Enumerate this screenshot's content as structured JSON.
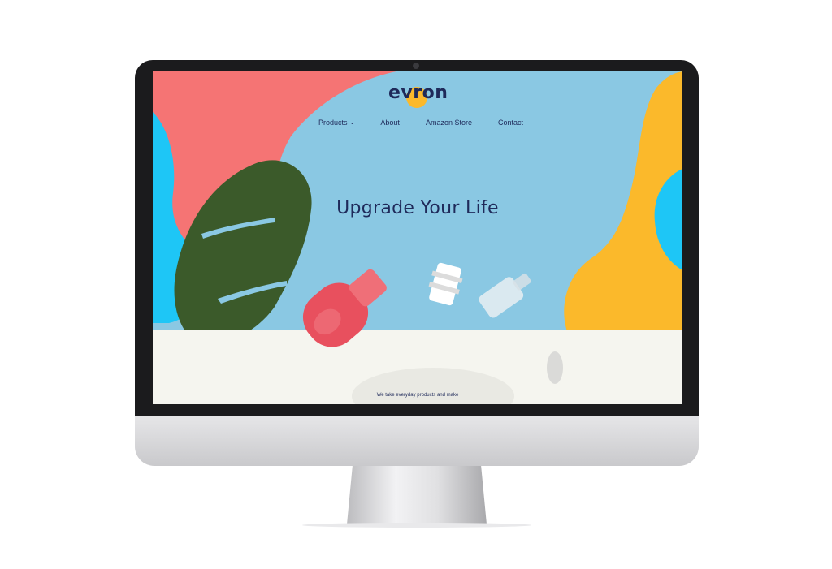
{
  "site": {
    "logo_text": "evron",
    "nav": [
      {
        "label": "Products",
        "has_dropdown": true
      },
      {
        "label": "About"
      },
      {
        "label": "Amazon Store"
      },
      {
        "label": "Contact"
      }
    ],
    "hero_title": "Upgrade Your Life",
    "tagline": "We take everyday products and make"
  },
  "colors": {
    "sky": "#8ac8e3",
    "coral": "#f57474",
    "yellow": "#fbb92b",
    "cyan": "#1ec6f6",
    "navy": "#1f2a5a",
    "cream": "#f5f5ef",
    "leaf": "#3b5a2a",
    "bottle": "#e8505e"
  },
  "icons": [
    "chevron-down-icon",
    "webcam-icon"
  ]
}
